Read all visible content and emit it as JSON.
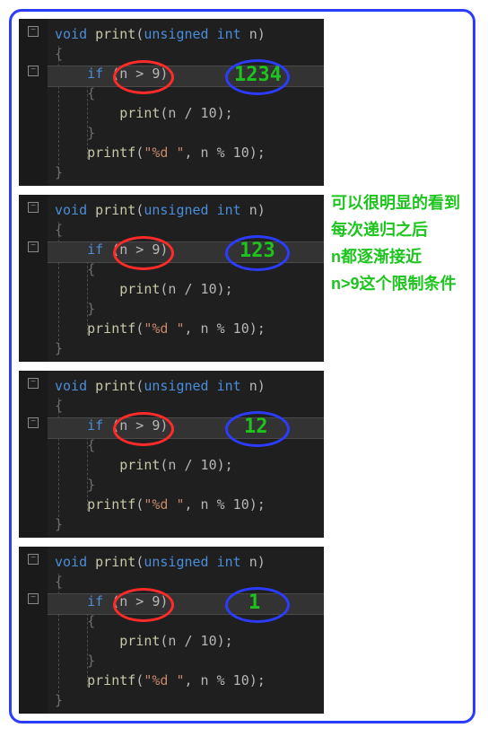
{
  "code": {
    "sig_kw_void": "void",
    "sig_fn": "print",
    "sig_open": "(",
    "sig_kw_unsigned": "unsigned",
    "sig_kw_int": "int",
    "sig_param": "n",
    "sig_close": ")",
    "br_open": "{",
    "br_close": "}",
    "if_kw": "if",
    "if_open": " (",
    "if_cond": "n > 9",
    "if_close": ")",
    "call_fn": "print",
    "call_args": "(n / 10);",
    "printf_fn": "printf",
    "printf_open": "(",
    "printf_fmt": "\"%d \"",
    "printf_rest": ", n % 10);"
  },
  "badges": {
    "p1": "1234",
    "p2": "123",
    "p3": "12",
    "p4": "1"
  },
  "side": {
    "l1": "可以很明显的看到",
    "l2": "每次递归之后",
    "l3": "n都逐渐接近",
    "l4": "n>9这个限制条件"
  },
  "fold_glyph": "−"
}
